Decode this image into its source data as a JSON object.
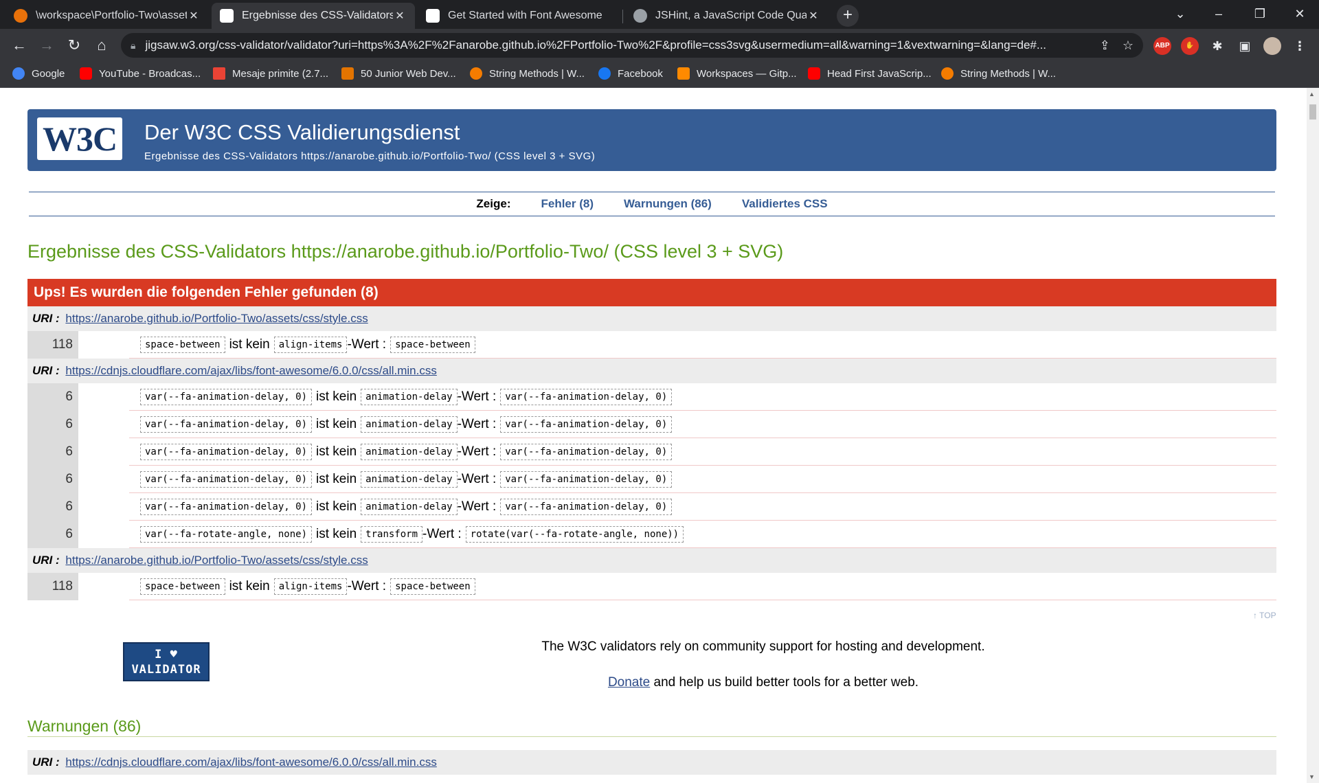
{
  "browser": {
    "tabs": [
      {
        "label": "\\workspace\\Portfolio-Two\\assets",
        "color": "#e8710a"
      },
      {
        "label": "Ergebnisse des CSS-Validators https:",
        "color": "#ffffff"
      },
      {
        "label": "Get Started with Font Awesome",
        "color": "#ffffff"
      },
      {
        "label": "JSHint, a JavaScript Code Quality",
        "color": "#9aa0a6"
      }
    ],
    "url": "jigsaw.w3.org/css-validator/validator?uri=https%3A%2F%2Fanarobe.github.io%2FPortfolio-Two%2F&profile=css3svg&usermedium=all&warning=1&vextwarning=&lang=de#...",
    "bookmarks": [
      {
        "label": "Google",
        "color": "#4285f4"
      },
      {
        "label": "YouTube - Broadcas...",
        "color": "#ff0000"
      },
      {
        "label": "Mesaje primite (2.7...",
        "color": "#ea4335"
      },
      {
        "label": "50 Junior Web Dev...",
        "color": "#e37400"
      },
      {
        "label": "String Methods | W...",
        "color": "#f57c00"
      },
      {
        "label": "Facebook",
        "color": "#1877f2"
      },
      {
        "label": "Workspaces — Gitp...",
        "color": "#ff8a00"
      },
      {
        "label": "Head First JavaScrip...",
        "color": "#ff0000"
      },
      {
        "label": "String Methods | W...",
        "color": "#f57c00"
      }
    ]
  },
  "header": {
    "logo": "W3C",
    "title": "Der W3C CSS Validierungsdienst",
    "subtitle": "Ergebnisse des CSS-Validators https://anarobe.github.io/Portfolio-Two/ (CSS level 3 + SVG)"
  },
  "nav": {
    "label": "Zeige:",
    "errors": "Fehler (8)",
    "warnings": "Warnungen (86)",
    "validated": "Validiertes CSS"
  },
  "results_title": "Ergebnisse des CSS-Validators https://anarobe.github.io/Portfolio-Two/ (CSS level 3 + SVG)",
  "errors": {
    "heading": "Ups! Es wurden die folgenden Fehler gefunden (8)",
    "uri_label": "URI :",
    "groups": [
      {
        "uri": "https://anarobe.github.io/Portfolio-Two/assets/css/style.css",
        "rows": [
          {
            "line": "118",
            "value": "space-between",
            "text": "ist kein",
            "prop": "align-items",
            "wert": "-Wert :",
            "actual": "space-between"
          }
        ]
      },
      {
        "uri": "https://cdnjs.cloudflare.com/ajax/libs/font-awesome/6.0.0/css/all.min.css",
        "rows": [
          {
            "line": "6",
            "value": "var(--fa-animation-delay, 0)",
            "text": "ist kein",
            "prop": "animation-delay",
            "wert": "-Wert :",
            "actual": "var(--fa-animation-delay, 0)"
          },
          {
            "line": "6",
            "value": "var(--fa-animation-delay, 0)",
            "text": "ist kein",
            "prop": "animation-delay",
            "wert": "-Wert :",
            "actual": "var(--fa-animation-delay, 0)"
          },
          {
            "line": "6",
            "value": "var(--fa-animation-delay, 0)",
            "text": "ist kein",
            "prop": "animation-delay",
            "wert": "-Wert :",
            "actual": "var(--fa-animation-delay, 0)"
          },
          {
            "line": "6",
            "value": "var(--fa-animation-delay, 0)",
            "text": "ist kein",
            "prop": "animation-delay",
            "wert": "-Wert :",
            "actual": "var(--fa-animation-delay, 0)"
          },
          {
            "line": "6",
            "value": "var(--fa-animation-delay, 0)",
            "text": "ist kein",
            "prop": "animation-delay",
            "wert": "-Wert :",
            "actual": "var(--fa-animation-delay, 0)"
          },
          {
            "line": "6",
            "value": "var(--fa-rotate-angle, none)",
            "text": "ist kein",
            "prop": "transform",
            "wert": "-Wert :",
            "actual": "rotate(var(--fa-rotate-angle, none))"
          }
        ]
      },
      {
        "uri": "https://anarobe.github.io/Portfolio-Two/assets/css/style.css",
        "rows": [
          {
            "line": "118",
            "value": "space-between",
            "text": "ist kein",
            "prop": "align-items",
            "wert": "-Wert :",
            "actual": "space-between"
          }
        ]
      }
    ]
  },
  "top_link": "↑ TOP",
  "support": {
    "badge_line1": "I ♥",
    "badge_line2": "VALIDATOR",
    "text": "The W3C validators rely on community support for hosting and development.",
    "donate": "Donate",
    "donate_rest": " and help us build better tools for a better web."
  },
  "warnings": {
    "heading": "Warnungen (86)",
    "uri_label": "URI :",
    "uri": "https://cdnjs.cloudflare.com/ajax/libs/font-awesome/6.0.0/css/all.min.css"
  }
}
